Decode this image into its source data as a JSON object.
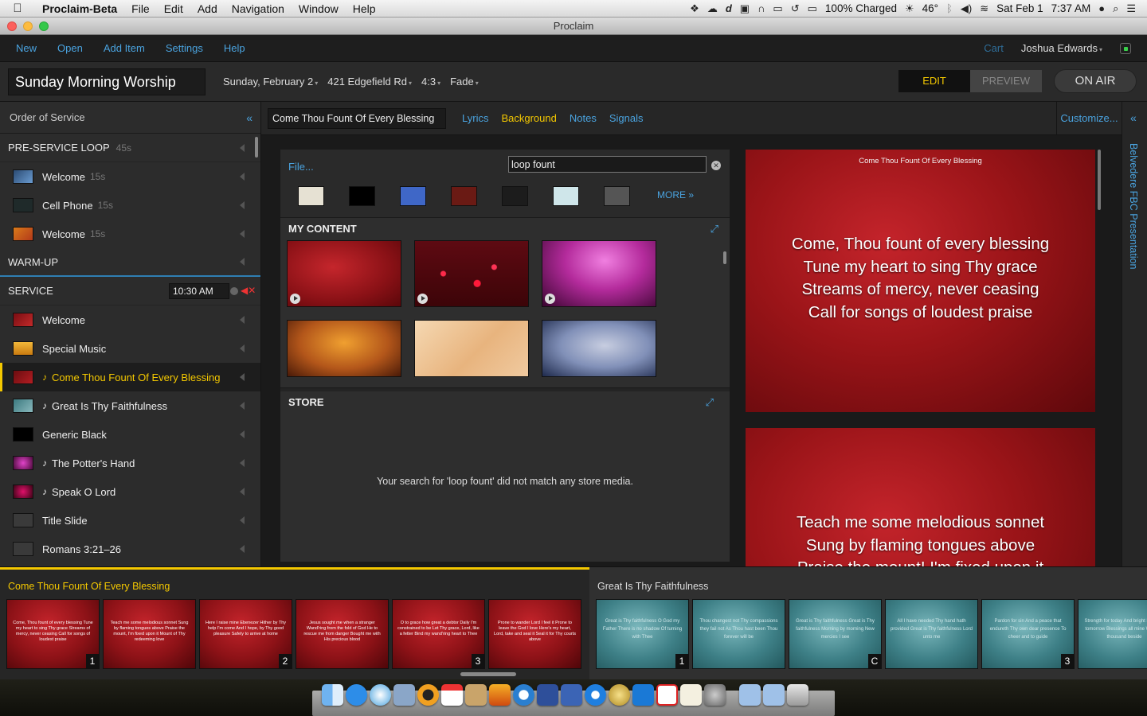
{
  "menubar": {
    "app": "Proclaim-Beta",
    "items": [
      "File",
      "Edit",
      "Add",
      "Navigation",
      "Window",
      "Help"
    ],
    "battery": "100% Charged",
    "temp": "46°",
    "date": "Sat Feb 1",
    "time": "7:37 AM"
  },
  "window": {
    "title": "Proclaim"
  },
  "appmenu": {
    "items": [
      "New",
      "Open",
      "Add Item",
      "Settings",
      "Help"
    ],
    "cart": "Cart",
    "user": "Joshua Edwards"
  },
  "service": {
    "title": "Sunday Morning Worship",
    "date": "Sunday, February 2",
    "location": "421 Edgefield Rd",
    "ratio": "4:3",
    "transition": "Fade",
    "edit": "EDIT",
    "preview": "PREVIEW",
    "onair": "ON AIR"
  },
  "sidebar": {
    "header": "Order of Service",
    "sections": {
      "preservice": {
        "label": "PRE-SERVICE LOOP",
        "duration": "45s"
      },
      "warmup": {
        "label": "WARM-UP"
      },
      "service": {
        "label": "SERVICE",
        "time": "10:30 AM"
      }
    },
    "preservice_items": [
      {
        "label": "Welcome",
        "duration": "15s",
        "thumb": "t-blue"
      },
      {
        "label": "Cell Phone",
        "duration": "15s",
        "thumb": "t-dark"
      },
      {
        "label": "Welcome",
        "duration": "15s",
        "thumb": "t-orange"
      }
    ],
    "service_items": [
      {
        "label": "Welcome",
        "thumb": "t-redtxt",
        "song": false
      },
      {
        "label": "Special Music",
        "thumb": "t-yellow",
        "song": false
      },
      {
        "label": "Come Thou Fount Of Every Blessing",
        "thumb": "t-red",
        "song": true,
        "active": true
      },
      {
        "label": "Great Is Thy Faithfulness",
        "thumb": "t-teal",
        "song": true
      },
      {
        "label": "Generic Black",
        "thumb": "t-black",
        "song": false
      },
      {
        "label": "The Potter's Hand",
        "thumb": "t-pink",
        "song": true
      },
      {
        "label": "Speak O Lord",
        "thumb": "t-magenta",
        "song": true
      },
      {
        "label": "Title Slide",
        "thumb": "t-gray",
        "song": false
      },
      {
        "label": "Romans 3:21–26",
        "thumb": "t-gray",
        "song": false
      }
    ]
  },
  "editor": {
    "item_title": "Come Thou Fount Of Every Blessing",
    "tabs": [
      "Lyrics",
      "Background",
      "Notes",
      "Signals"
    ],
    "selected_tab": "Background",
    "customize": "Customize...",
    "right_panel": "Belvedere FBC Presentation"
  },
  "media": {
    "file": "File...",
    "search": "loop fount",
    "more": "MORE »",
    "swatch_colors": [
      "#e6e1d3",
      "#000000",
      "#3f67c7",
      "#6a1a14",
      "#1c1c1c",
      "#cfe6ea",
      "#555555"
    ],
    "my_content": "MY CONTENT",
    "store": "STORE",
    "store_message": "Your search for 'loop fount' did not match any store media."
  },
  "preview": {
    "song_title": "Come Thou Fount Of Every Blessing",
    "slide1": [
      "Come, Thou fount of every blessing",
      "Tune my heart to sing Thy grace",
      "Streams of mercy, never ceasing",
      "Call for songs of loudest praise"
    ],
    "slide2": [
      "Teach me some melodious sonnet",
      "Sung by flaming tongues above",
      "Praise the mount! I'm fixed upon it"
    ]
  },
  "filmstrip": {
    "left_title": "Come Thou Fount Of Every Blessing",
    "right_title": "Great Is Thy Faithfulness",
    "left_slides": [
      {
        "text": "Come, Thou fount of every blessing Tune my heart to sing Thy grace Streams of mercy, never ceasing Call for songs of loudest praise",
        "badge": "1"
      },
      {
        "text": "Teach me some melodious sonnet Sung by flaming tongues above Praise the mount, I'm fixed upon it Mount of Thy redeeming love",
        "badge": ""
      },
      {
        "text": "Here I raise mine Ebenezer Hither by Thy help I'm come And I hope, by Thy good pleasure Safely to arrive at home",
        "badge": "2"
      },
      {
        "text": "Jesus sought me when a stranger Wand'ring from the fold of God He to rescue me from danger Bought me with His precious blood",
        "badge": ""
      },
      {
        "text": "O to grace how great a debtor Daily I'm constrained to be Let Thy grace, Lord, like a fetter Bind my wand'ring heart to Thee",
        "badge": "3"
      },
      {
        "text": "Prone to wander Lord I feel it Prone to leave the God I love Here's my heart, Lord, take and seal it Seal it for Thy courts above",
        "badge": ""
      }
    ],
    "right_slides": [
      {
        "text": "Great is Thy faithfulness O God my Father There is no shadow Of turning with Thee",
        "badge": "1"
      },
      {
        "text": "Thou changest not Thy compassions they fail not As Thou hast been Thou forever will be",
        "badge": ""
      },
      {
        "text": "Great is Thy faithfulness Great is Thy faithfulness Morning by morning New mercies I see",
        "badge": "C"
      },
      {
        "text": "All I have needed Thy hand hath provided Great is Thy faithfulness Lord unto me",
        "badge": ""
      },
      {
        "text": "Pardon for sin And a peace that endureth Thy own dear presence To cheer and to guide",
        "badge": "3"
      },
      {
        "text": "Strength for today And bright hope for tomorrow Blessings all mine With ten thousand beside",
        "badge": ""
      }
    ]
  }
}
